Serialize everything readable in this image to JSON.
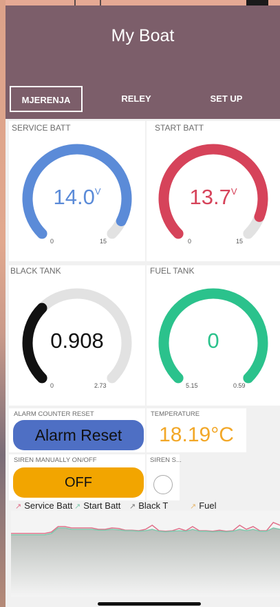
{
  "app": {
    "title": "My Boat"
  },
  "tabs": [
    {
      "label": "MJERENJA",
      "active": true
    },
    {
      "label": "RELEY",
      "active": false
    },
    {
      "label": "SET UP",
      "active": false
    }
  ],
  "gauges": [
    {
      "label": "SERVICE BATT",
      "value": "14.0",
      "unit": "V",
      "min": "0",
      "max": "15",
      "level": 0.933,
      "color": "#5b8bd8"
    },
    {
      "label": "START BATT",
      "value": "13.7",
      "unit": "V",
      "min": "0",
      "max": "15",
      "level": 0.913,
      "color": "#d6435a"
    },
    {
      "label": "BLACK TANK",
      "value": "0.908",
      "unit": "",
      "min": "0",
      "max": "2.73",
      "level": 0.333,
      "color": "#111111"
    },
    {
      "label": "FUEL TANK",
      "value": "0",
      "unit": "",
      "min": "5.15",
      "max": "0.59",
      "level": 1.0,
      "color": "#2bc28c"
    }
  ],
  "alarm_reset": {
    "label": "ALARM COUNTER RESET",
    "button": "Alarm Reset",
    "color": "#4e6fc4"
  },
  "temperature": {
    "label": "TEMPERATURE",
    "value": "18.19°C",
    "color": "#f2a727"
  },
  "siren_manual": {
    "label": "SIREN MANUALLY ON/OFF",
    "button": "OFF",
    "color": "#f2a500"
  },
  "siren_status": {
    "label": "SIREN S..."
  },
  "chart_data": {
    "type": "line",
    "series": [
      {
        "name": "Service Batt",
        "color": "#e0708a",
        "values": [
          0.3,
          0.3,
          0.3,
          0.3,
          0.3,
          0.3,
          0.35,
          0.55,
          0.55,
          0.5,
          0.5,
          0.5,
          0.5,
          0.45,
          0.45,
          0.5,
          0.48,
          0.42,
          0.42,
          0.4,
          0.45,
          0.6,
          0.4,
          0.38,
          0.4,
          0.48,
          0.4,
          0.55,
          0.4,
          0.4,
          0.38,
          0.42,
          0.38,
          0.4,
          0.6,
          0.45,
          0.55,
          0.4,
          0.4,
          0.7,
          0.6
        ]
      },
      {
        "name": "Start Batt",
        "color": "#7fc9ae",
        "values": [
          0.25,
          0.25,
          0.25,
          0.25,
          0.25,
          0.25,
          0.3,
          0.5,
          0.5,
          0.45,
          0.45,
          0.45,
          0.45,
          0.42,
          0.42,
          0.45,
          0.43,
          0.4,
          0.4,
          0.38,
          0.4,
          0.45,
          0.38,
          0.36,
          0.38,
          0.4,
          0.38,
          0.45,
          0.38,
          0.38,
          0.36,
          0.38,
          0.36,
          0.38,
          0.45,
          0.4,
          0.45,
          0.38,
          0.38,
          0.5,
          0.45
        ]
      },
      {
        "name": "Black T",
        "color": "#777777",
        "values": []
      },
      {
        "name": "Fuel",
        "color": "#e6b870",
        "values": []
      }
    ]
  }
}
